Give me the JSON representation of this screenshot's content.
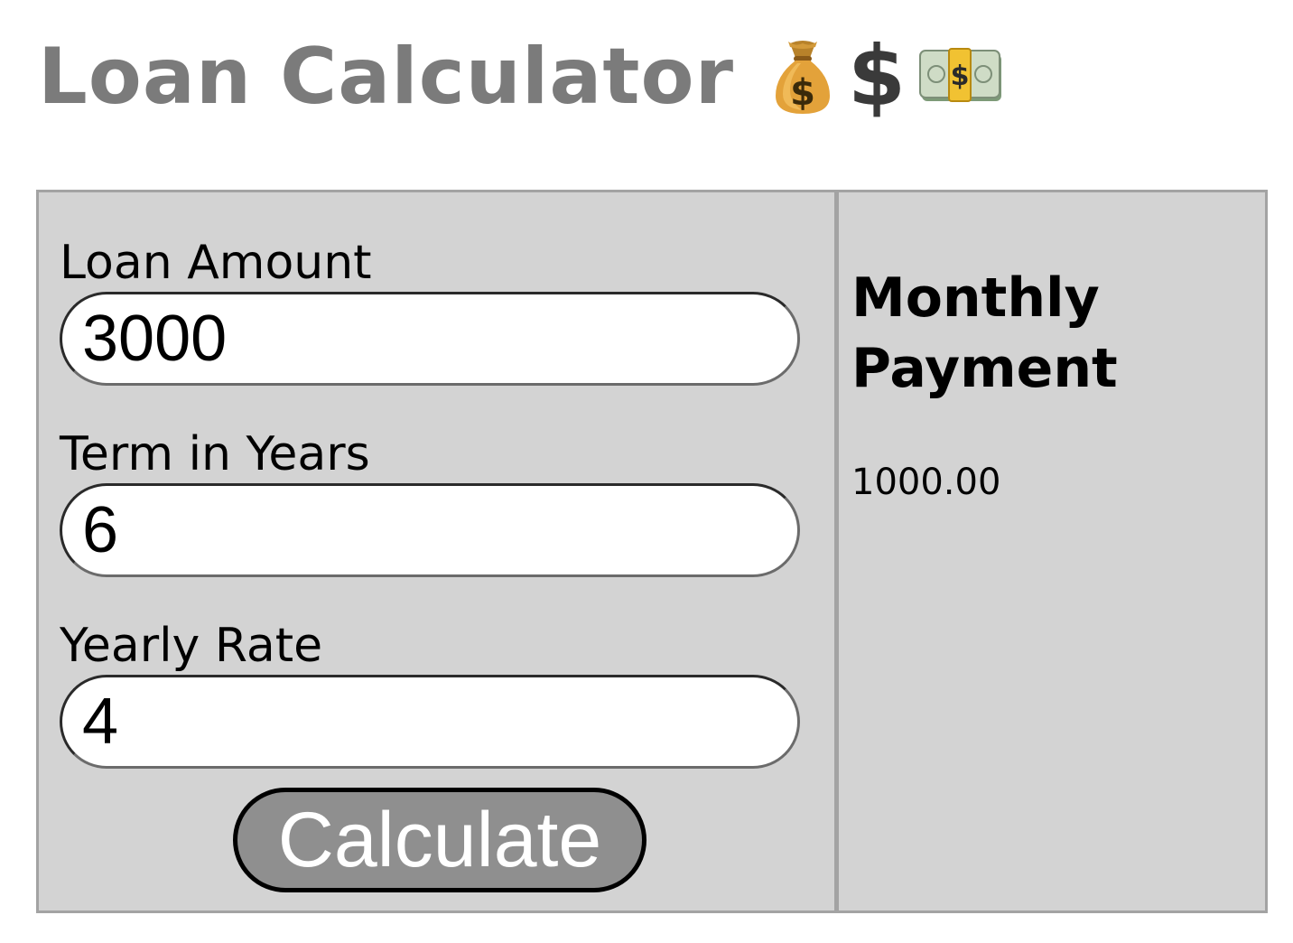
{
  "header": {
    "title": "Loan Calculator",
    "icons": [
      "money-bag-icon",
      "dollar-sign-icon",
      "dollar-banknote-icon"
    ],
    "dollar_glyph": "$",
    "money_bag_glyph": "$",
    "banknote_glyph": "$"
  },
  "form": {
    "loan_amount": {
      "label": "Loan Amount",
      "value": "3000"
    },
    "term_years": {
      "label": "Term in Years",
      "value": "6"
    },
    "yearly_rate": {
      "label": "Yearly Rate",
      "value": "4"
    },
    "submit_label": "Calculate"
  },
  "result": {
    "heading": "Monthly Payment",
    "value": "1000.00"
  },
  "colors": {
    "title": "#7b7b7b",
    "panel_bg": "#d3d3d3",
    "panel_border": "#a3a3a3",
    "button_bg": "#8f8f8f",
    "button_text": "#ffffff"
  }
}
